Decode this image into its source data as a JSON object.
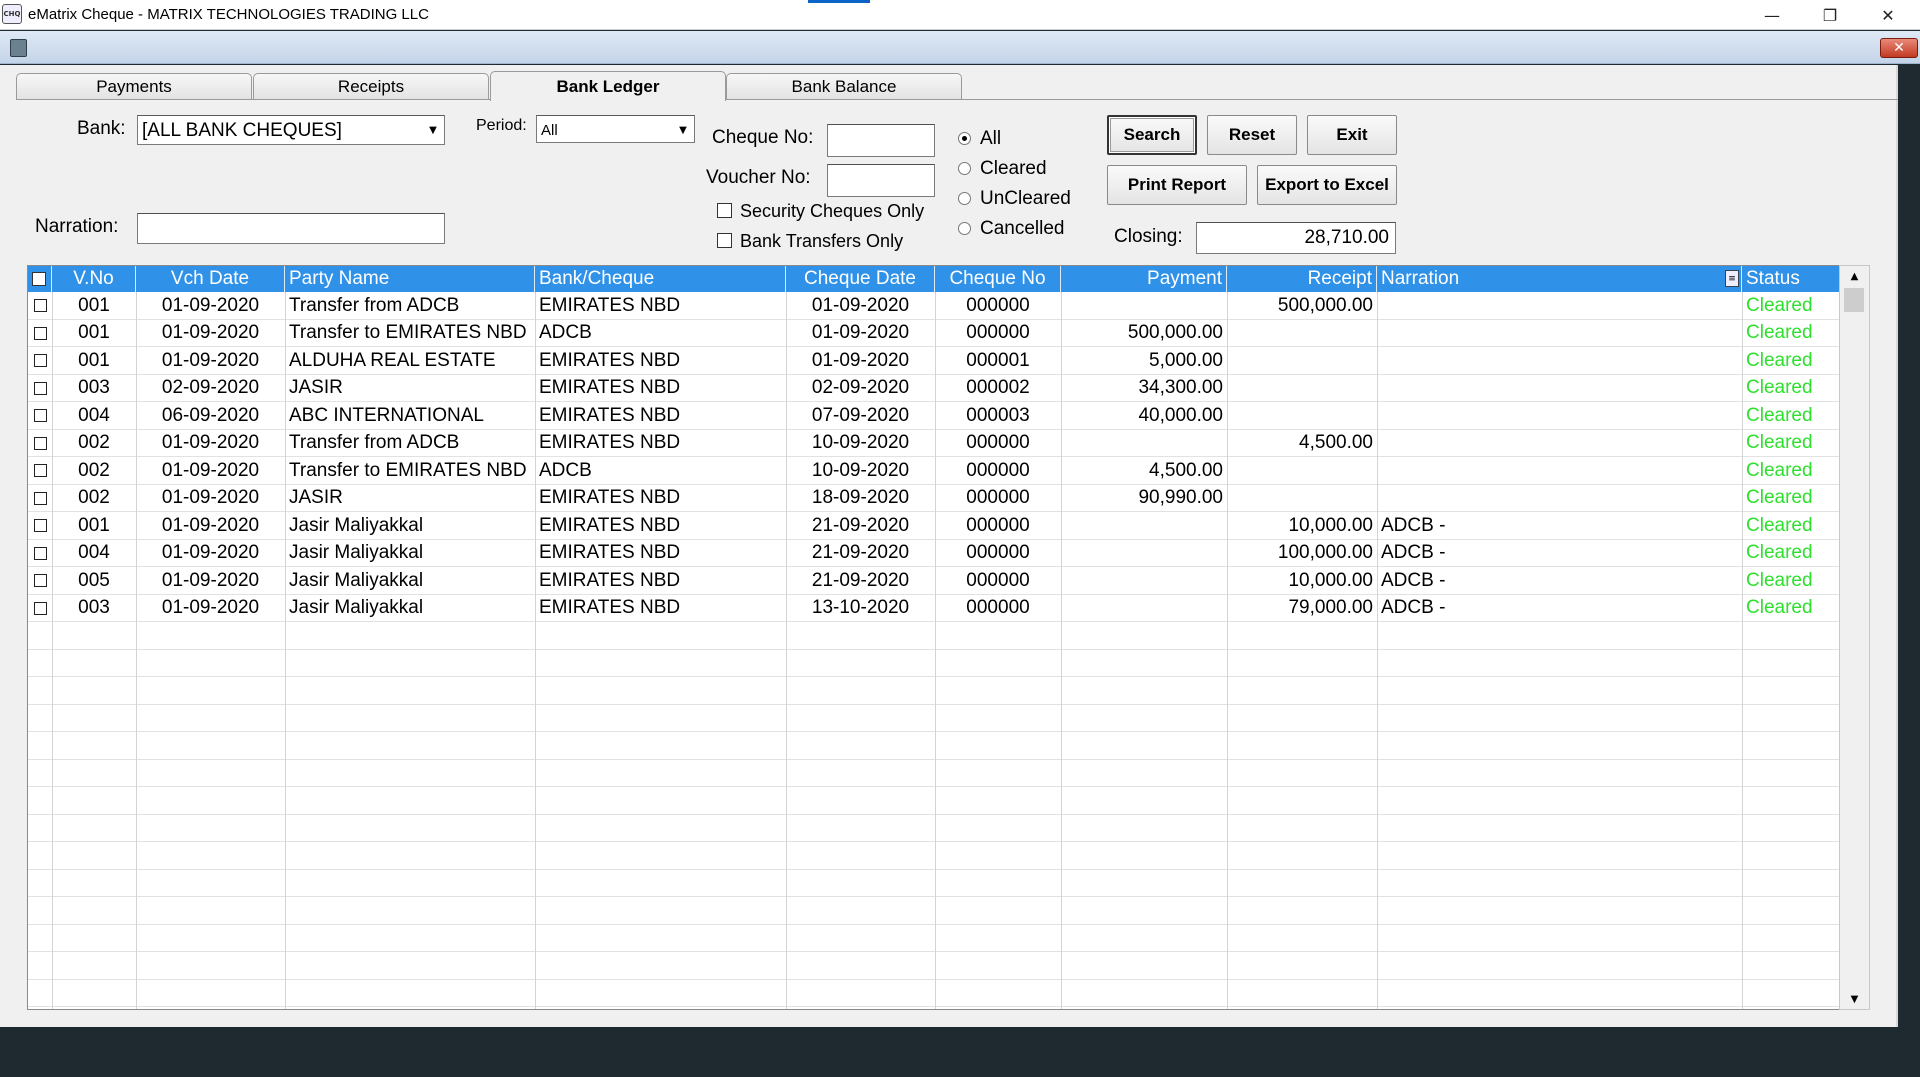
{
  "window": {
    "title": "eMatrix Cheque - MATRIX TECHNOLOGIES TRADING LLC",
    "app_icon": "CHQ",
    "minimize_glyph": "—",
    "restore_glyph": "❐",
    "close_glyph": "✕",
    "mdi_close_glyph": "✕"
  },
  "tabs": [
    "Payments",
    "Receipts",
    "Bank Ledger",
    "Bank Balance"
  ],
  "active_tab": "Bank Ledger",
  "filters": {
    "bank_label": "Bank:",
    "bank_value": "[ALL BANK CHEQUES]",
    "period_label": "Period:",
    "period_value": "All",
    "narration_label": "Narration:",
    "narration_value": "",
    "cheque_no_label": "Cheque No:",
    "cheque_no_value": "",
    "voucher_no_label": "Voucher No:",
    "voucher_no_value": "",
    "security_cheques_label": "Security Cheques Only",
    "bank_transfers_label": "Bank Transfers Only",
    "status_options": [
      "All",
      "Cleared",
      "UnCleared",
      "Cancelled"
    ],
    "status_selected": "All",
    "closing_label": "Closing:",
    "closing_value": "28,710.00"
  },
  "buttons": {
    "search": "Search",
    "reset": "Reset",
    "exit": "Exit",
    "print_report": "Print Report",
    "export_excel": "Export to Excel"
  },
  "grid": {
    "columns": [
      "V.No",
      "Vch Date",
      "Party Name",
      "Bank/Cheque",
      "Cheque Date",
      "Cheque No",
      "Payment",
      "Receipt",
      "Narration",
      "Status"
    ],
    "rows": [
      [
        "001",
        "01-09-2020",
        "Transfer from ADCB",
        "EMIRATES NBD",
        "01-09-2020",
        "000000",
        "",
        "500,000.00",
        "",
        "Cleared"
      ],
      [
        "001",
        "01-09-2020",
        "Transfer to EMIRATES NBD",
        "ADCB",
        "01-09-2020",
        "000000",
        "500,000.00",
        "",
        "",
        "Cleared"
      ],
      [
        "001",
        "01-09-2020",
        "ALDUHA REAL ESTATE",
        "EMIRATES NBD",
        "01-09-2020",
        "000001",
        "5,000.00",
        "",
        "",
        "Cleared"
      ],
      [
        "003",
        "02-09-2020",
        "JASIR",
        "EMIRATES NBD",
        "02-09-2020",
        "000002",
        "34,300.00",
        "",
        "",
        "Cleared"
      ],
      [
        "004",
        "06-09-2020",
        "ABC INTERNATIONAL",
        "EMIRATES NBD",
        "07-09-2020",
        "000003",
        "40,000.00",
        "",
        "",
        "Cleared"
      ],
      [
        "002",
        "01-09-2020",
        "Transfer from ADCB",
        "EMIRATES NBD",
        "10-09-2020",
        "000000",
        "",
        "4,500.00",
        "",
        "Cleared"
      ],
      [
        "002",
        "01-09-2020",
        "Transfer to EMIRATES NBD",
        "ADCB",
        "10-09-2020",
        "000000",
        "4,500.00",
        "",
        "",
        "Cleared"
      ],
      [
        "002",
        "01-09-2020",
        "JASIR",
        "EMIRATES NBD",
        "18-09-2020",
        "000000",
        "90,990.00",
        "",
        "",
        "Cleared"
      ],
      [
        "001",
        "01-09-2020",
        "Jasir Maliyakkal",
        "EMIRATES NBD",
        "21-09-2020",
        "000000",
        "",
        "10,000.00",
        "ADCB -",
        "Cleared"
      ],
      [
        "004",
        "01-09-2020",
        "Jasir Maliyakkal",
        "EMIRATES NBD",
        "21-09-2020",
        "000000",
        "",
        "100,000.00",
        "ADCB -",
        "Cleared"
      ],
      [
        "005",
        "01-09-2020",
        "Jasir Maliyakkal",
        "EMIRATES NBD",
        "21-09-2020",
        "000000",
        "",
        "10,000.00",
        "ADCB -",
        "Cleared"
      ],
      [
        "003",
        "01-09-2020",
        "Jasir Maliyakkal",
        "EMIRATES NBD",
        "13-10-2020",
        "000000",
        "",
        "79,000.00",
        "ADCB -",
        "Cleared"
      ]
    ],
    "empty_rows": 14,
    "status_color": "#2ee02e",
    "header_color": "#2f91e8"
  }
}
